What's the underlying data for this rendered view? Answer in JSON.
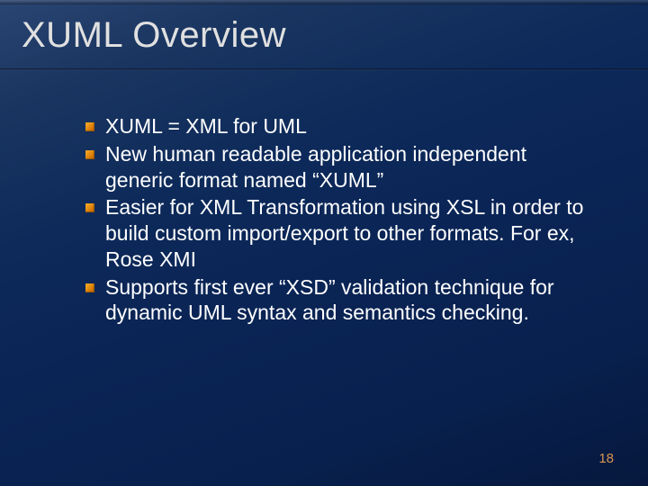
{
  "slide": {
    "title": "XUML Overview",
    "bullets": [
      "XUML = XML for UML",
      "New human readable application independent generic format named “XUML”",
      "Easier for XML Transformation using XSL in order to build custom import/export to other formats. For ex, Rose XMI",
      "Supports first ever “XSD” validation technique for dynamic UML syntax and semantics checking."
    ],
    "page_number": "18"
  }
}
